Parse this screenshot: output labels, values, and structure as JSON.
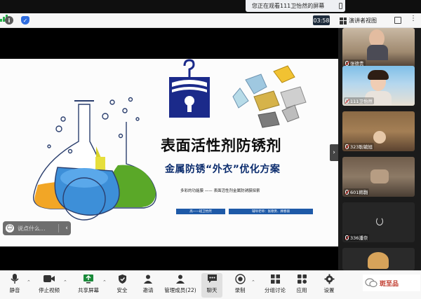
{
  "share_banner": {
    "text": "您正在观看111卫怡然的屏幕"
  },
  "toolbar": {
    "timer": "03:58",
    "presenter_view": "演讲者视图"
  },
  "slide": {
    "title": "表面活性剂防锈剂",
    "subtitle": "金属防锈“外衣”优化方案",
    "tagline": "多彩的功能膜 —— 表面活性剂金属防锈膜探索",
    "label_class": "高一一班卫怡然",
    "label_teacher": "辅导老师：张德贵、顾春丽"
  },
  "comment": {
    "placeholder": "说点什么..."
  },
  "participants": [
    {
      "name": "张德贵"
    },
    {
      "name": "111卫怡然"
    },
    {
      "name": "323耿毓旭"
    },
    {
      "name": "601韩翾"
    },
    {
      "name": "336潘奈"
    }
  ],
  "bottombar": {
    "mute": "静音",
    "stop_video": "停止视频",
    "share_screen": "共享屏幕",
    "security": "安全",
    "invite": "邀请",
    "manage_members": "管理成员(22)",
    "chat": "聊天",
    "record": "录制",
    "breakout": "分组讨论",
    "apps": "应用",
    "settings": "设置"
  },
  "watermark": {
    "text": "斑至品"
  },
  "colors": {
    "slide_blue": "#1e5aa8",
    "title_dark": "#0d0d0d",
    "subtitle_navy": "#0c2d6e"
  }
}
